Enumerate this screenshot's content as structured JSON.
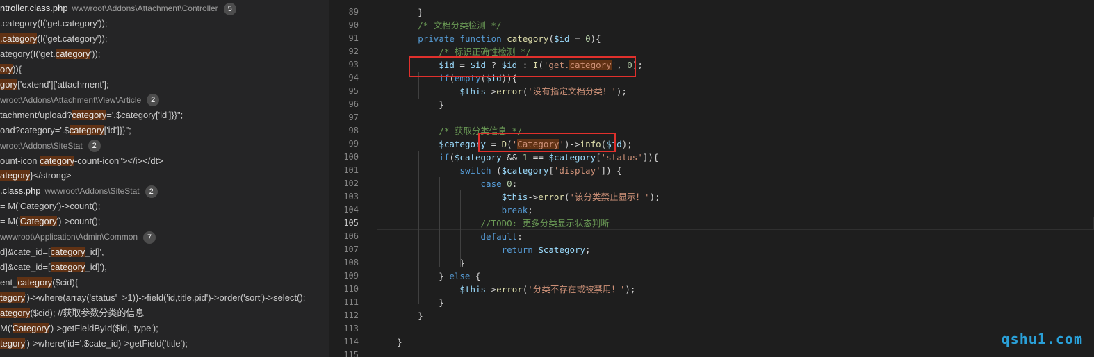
{
  "search": {
    "results": [
      {
        "type": "file",
        "file": "ntroller.class.php",
        "path": "wwwroot\\Addons\\Attachment\\Controller",
        "count": "5"
      },
      {
        "type": "match",
        "pre": "",
        "hl": "",
        "post": ".category(I('get.category'));"
      },
      {
        "type": "match",
        "pre": "",
        "hl": ".category",
        "post": "(I('get.category'));"
      },
      {
        "type": "match",
        "pre": "ategory(I('get.",
        "hl": "category",
        "post": "'));"
      },
      {
        "type": "match",
        "pre": "",
        "hl": "ory",
        "post": ")){"
      },
      {
        "type": "match",
        "pre": "",
        "hl": "gory",
        "post": "['extend']['attachment'];"
      },
      {
        "type": "file",
        "file": "",
        "path": "wroot\\Addons\\Attachment\\View\\Article",
        "count": "2"
      },
      {
        "type": "match",
        "pre": "tachment/upload?",
        "hl": "category",
        "post": "='.$category['id']}}\";"
      },
      {
        "type": "match",
        "pre": "oad?category='.$",
        "hl": "category",
        "post": "['id']}}\";"
      },
      {
        "type": "file",
        "file": "",
        "path": "wroot\\Addons\\SiteStat",
        "count": "2"
      },
      {
        "type": "match",
        "pre": "ount-icon ",
        "hl": "category",
        "post": "-count-icon\"></i></dt>"
      },
      {
        "type": "match",
        "pre": "",
        "hl": "ategory",
        "post": "}</strong>"
      },
      {
        "type": "file",
        "file": ".class.php",
        "path": "wwwroot\\Addons\\SiteStat",
        "count": "2"
      },
      {
        "type": "match",
        "pre": "        =      M('Category')->count();",
        "hl": "",
        "post": ""
      },
      {
        "type": "match",
        "pre": "        =      M('",
        "hl": "Category",
        "post": "')->count();"
      },
      {
        "type": "file",
        "file": "",
        "path": "wwwroot\\Application\\Admin\\Common",
        "count": "7"
      },
      {
        "type": "match",
        "pre": "d]&cate_id=[",
        "hl": "category",
        "post": "_id]',"
      },
      {
        "type": "match",
        "pre": "d]&cate_id=[",
        "hl": "category",
        "post": "_id]'),"
      },
      {
        "type": "match",
        "pre": "ent_",
        "hl": "category",
        "post": "($cid){"
      },
      {
        "type": "match",
        "pre": "",
        "hl": "tegory",
        "post": "')->where(array('status'=>1))->field('id,title,pid')->order('sort')->select();"
      },
      {
        "type": "match",
        "pre": "",
        "hl": "ategory",
        "post": "($cid); //获取参数分类的信息"
      },
      {
        "type": "match",
        "pre": " M('",
        "hl": "Category",
        "post": "')->getFieldById($id, 'type');"
      },
      {
        "type": "match",
        "pre": "",
        "hl": "tegory",
        "post": "')->where('id='.$cate_id)->getField('title');"
      }
    ]
  },
  "editor": {
    "lines": [
      {
        "n": "89",
        "code": "        }"
      },
      {
        "n": "90",
        "code": "        /* 文档分类检测 */"
      },
      {
        "n": "91",
        "code": "        private function category($id = 0){"
      },
      {
        "n": "92",
        "code": "            /* 标识正确性检测 */"
      },
      {
        "n": "93",
        "code": "            $id = $id ? $id : I('get.category', 0);"
      },
      {
        "n": "94",
        "code": "            if(empty($id)){"
      },
      {
        "n": "95",
        "code": "                $this->error('没有指定文档分类！');"
      },
      {
        "n": "96",
        "code": "            }"
      },
      {
        "n": "97",
        "code": ""
      },
      {
        "n": "98",
        "code": "            /* 获取分类信息 */"
      },
      {
        "n": "99",
        "code": "            $category = D('Category')->info($id);"
      },
      {
        "n": "100",
        "code": "            if($category && 1 == $category['status']){"
      },
      {
        "n": "101",
        "code": "                switch ($category['display']) {"
      },
      {
        "n": "102",
        "code": "                    case 0:"
      },
      {
        "n": "103",
        "code": "                        $this->error('该分类禁止显示！');"
      },
      {
        "n": "104",
        "code": "                        break;"
      },
      {
        "n": "105",
        "code": "                    //TODO: 更多分类显示状态判断"
      },
      {
        "n": "106",
        "code": "                    default:"
      },
      {
        "n": "107",
        "code": "                        return $category;"
      },
      {
        "n": "108",
        "code": "                }"
      },
      {
        "n": "109",
        "code": "            } else {"
      },
      {
        "n": "110",
        "code": "                $this->error('分类不存在或被禁用！');"
      },
      {
        "n": "111",
        "code": "            }"
      },
      {
        "n": "112",
        "code": "        }"
      },
      {
        "n": "113",
        "code": ""
      },
      {
        "n": "114",
        "code": "    }"
      },
      {
        "n": "115",
        "code": ""
      }
    ],
    "active_line": "105"
  },
  "watermark": "qshu1.com",
  "colors": {
    "highlight": "#613214",
    "annotation_box": "#e0302c",
    "keyword": "#569cd6",
    "comment": "#6a9955",
    "string": "#ce9178"
  }
}
